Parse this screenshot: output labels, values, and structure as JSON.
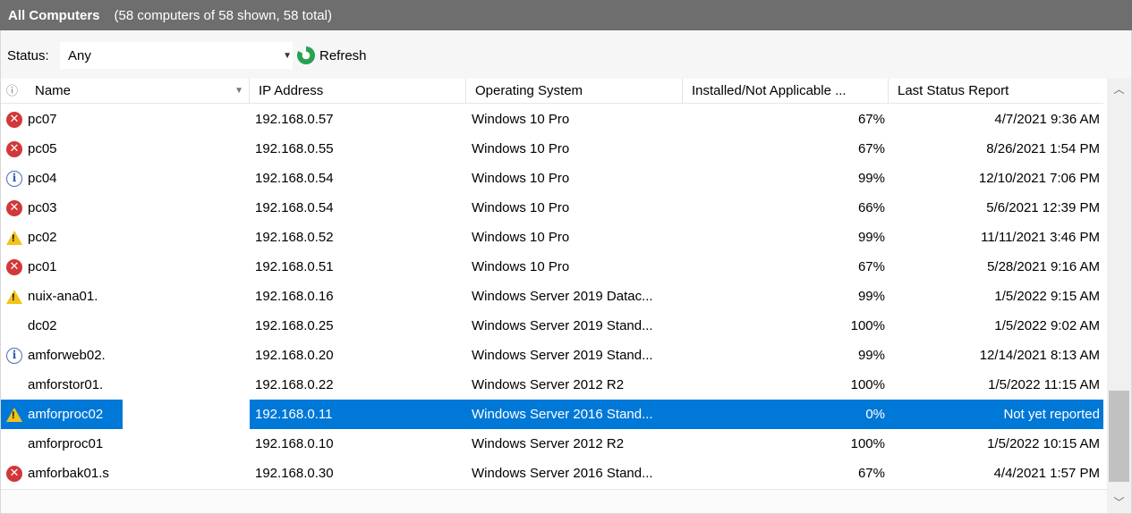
{
  "title": {
    "main": "All Computers",
    "count": "(58 computers of 58 shown, 58 total)"
  },
  "toolbar": {
    "status_label": "Status:",
    "status_value": "Any",
    "refresh_label": "Refresh"
  },
  "columns": {
    "info": "ⓘ",
    "name": "Name",
    "ip": "IP Address",
    "os": "Operating System",
    "installed": "Installed/Not Applicable ...",
    "last": "Last Status Report"
  },
  "rows": [
    {
      "status": "error",
      "name": "pc07",
      "ip": "192.168.0.57",
      "os": "Windows 10 Pro",
      "installed": "67%",
      "last": "4/7/2021 9:36 AM"
    },
    {
      "status": "error",
      "name": "pc05",
      "ip": "192.168.0.55",
      "os": "Windows 10 Pro",
      "installed": "67%",
      "last": "8/26/2021 1:54 PM"
    },
    {
      "status": "info",
      "name": "pc04",
      "ip": "192.168.0.54",
      "os": "Windows 10 Pro",
      "installed": "99%",
      "last": "12/10/2021 7:06 PM"
    },
    {
      "status": "error",
      "name": "pc03",
      "ip": "192.168.0.54",
      "os": "Windows 10 Pro",
      "installed": "66%",
      "last": "5/6/2021 12:39 PM"
    },
    {
      "status": "warning",
      "name": "pc02",
      "ip": "192.168.0.52",
      "os": "Windows 10 Pro",
      "installed": "99%",
      "last": "11/11/2021 3:46 PM"
    },
    {
      "status": "error",
      "name": "pc01",
      "ip": "192.168.0.51",
      "os": "Windows 10 Pro",
      "installed": "67%",
      "last": "5/28/2021 9:16 AM"
    },
    {
      "status": "warning",
      "name": "nuix-ana01.",
      "ip": "192.168.0.16",
      "os": "Windows Server 2019 Datac...",
      "installed": "99%",
      "last": "1/5/2022 9:15 AM"
    },
    {
      "status": "none",
      "name": "dc02",
      "ip": "192.168.0.25",
      "os": "Windows Server 2019 Stand...",
      "installed": "100%",
      "last": "1/5/2022 9:02 AM"
    },
    {
      "status": "info",
      "name": "amforweb02.",
      "ip": "192.168.0.20",
      "os": "Windows Server 2019 Stand...",
      "installed": "99%",
      "last": "12/14/2021 8:13 AM"
    },
    {
      "status": "none",
      "name": "amforstor01.",
      "ip": "192.168.0.22",
      "os": "Windows Server 2012 R2",
      "installed": "100%",
      "last": "1/5/2022 11:15 AM"
    },
    {
      "status": "warning",
      "name": "amforproc02",
      "ip": "192.168.0.11",
      "os": "Windows Server 2016 Stand...",
      "installed": "0%",
      "last": "Not yet reported",
      "selected": true
    },
    {
      "status": "none",
      "name": "amforproc01",
      "ip": "192.168.0.10",
      "os": "Windows Server 2012 R2",
      "installed": "100%",
      "last": "1/5/2022 10:15 AM"
    },
    {
      "status": "error",
      "name": "amforbak01.s",
      "ip": "192.168.0.30",
      "os": "Windows Server 2016 Stand...",
      "installed": "67%",
      "last": "4/4/2021 1:57 PM"
    }
  ],
  "icons": {
    "error": "error-icon",
    "info": "info-icon",
    "warning": "warning-icon",
    "refresh": "refresh-icon",
    "sort": "sort-down-icon",
    "scroll_up": "chevron-up-icon",
    "scroll_down": "chevron-down-icon"
  },
  "colors": {
    "titlebar": "#6e6e6e",
    "selection": "#0078d7",
    "error": "#d2383a",
    "warning": "#f2c21a",
    "info": "#2d5aa8",
    "refresh": "#2aa152"
  }
}
